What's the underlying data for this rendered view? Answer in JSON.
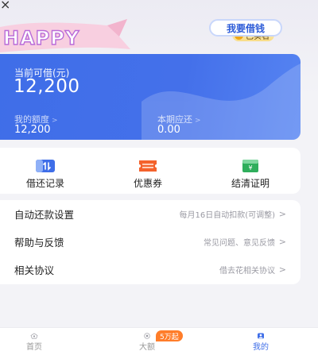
{
  "header": {
    "back_glyph": "×",
    "ribbon_text": "HAPPY",
    "verified_badge": "已实名",
    "verified_icon": "verified-check-icon"
  },
  "loan_card": {
    "available_label": "当前可借(元)",
    "available_amount": "12,200",
    "borrow_button": "我要借钱",
    "limit_label": "我的额度",
    "limit_value": "12,200",
    "due_label": "本期应还",
    "due_value": "0.00",
    "chevron": ">"
  },
  "quick_actions": [
    {
      "label": "借还记录",
      "icon": "records-icon",
      "color": "#3f6ee8"
    },
    {
      "label": "优惠券",
      "icon": "coupon-icon",
      "color": "#f4622c"
    },
    {
      "label": "结清证明",
      "icon": "certificate-icon",
      "color": "#2fae5c"
    }
  ],
  "menu": [
    {
      "title": "自动还款设置",
      "desc": "每月16日自动扣款(可调整)",
      "chevron": ">"
    },
    {
      "title": "帮助与反馈",
      "desc": "常见问题、意见反馈",
      "chevron": ">"
    },
    {
      "title": "相关协议",
      "desc": "借去花相关协议",
      "chevron": ">"
    }
  ],
  "tabbar": {
    "tabs": [
      {
        "label": "首页",
        "icon": "home-icon"
      },
      {
        "label": "大额",
        "icon": "large-loan-icon"
      },
      {
        "label": "我的",
        "icon": "profile-icon"
      }
    ],
    "active_index": 2,
    "promo_badge": "5万起"
  },
  "colors": {
    "accent": "#3f6ee8",
    "background": "#f3f3f7",
    "badge_gold": "#f0a818",
    "promo": "#ff7d2a"
  }
}
